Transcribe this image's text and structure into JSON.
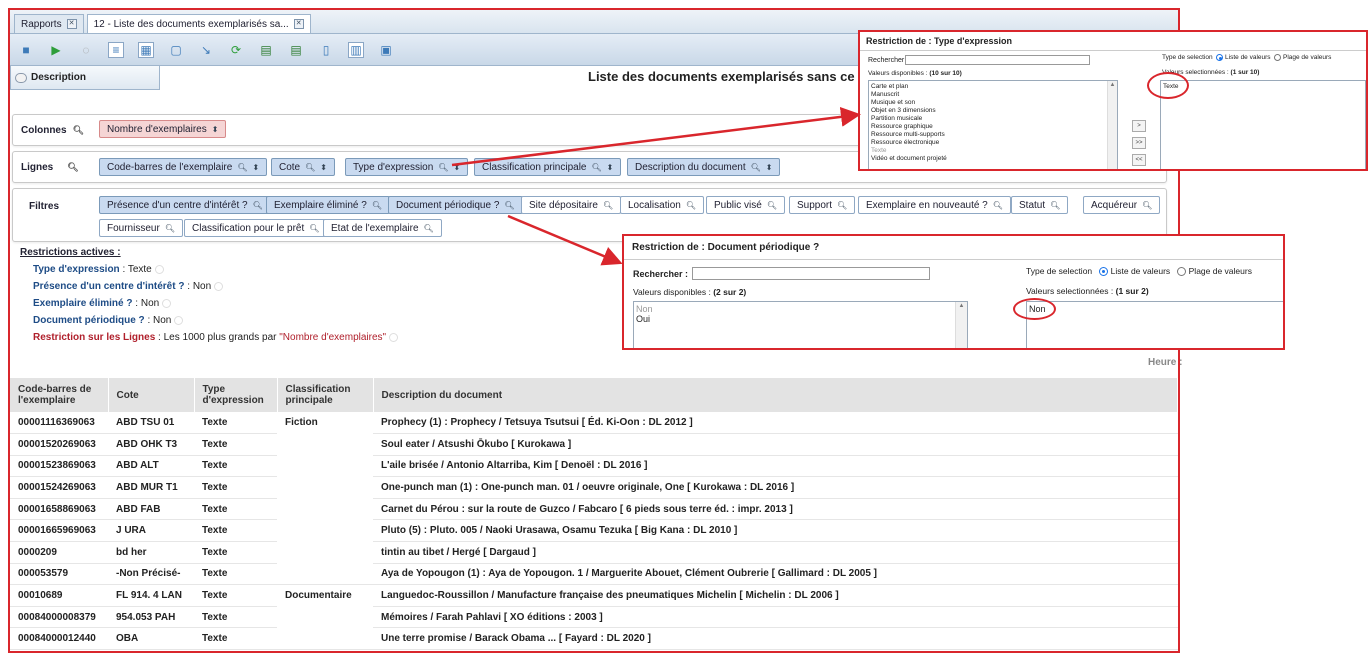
{
  "tabs": [
    {
      "label": "Rapports"
    },
    {
      "label": "12 - Liste des documents exemplarisés sa..."
    }
  ],
  "description_label": "Description",
  "report_title": "Liste des documents exemplarisés sans ce",
  "colonnes": {
    "label": "Colonnes",
    "chips": [
      "Nombre d'exemplaires"
    ]
  },
  "lignes": {
    "label": "Lignes",
    "chips": [
      "Code-barres de l'exemplaire",
      "Cote",
      "Type d'expression",
      "Classification principale",
      "Description du document"
    ]
  },
  "filtres": {
    "label": "Filtres",
    "row1": [
      "Présence d'un centre d'intérêt ?",
      "Exemplaire éliminé ?",
      "Document périodique ?",
      "Site dépositaire",
      "Localisation",
      "Public visé",
      "Support",
      "Exemplaire en nouveauté ?",
      "Statut",
      "Acquéreur"
    ],
    "row2": [
      "Fournisseur",
      "Classification pour le prêt",
      "Etat de l'exemplaire"
    ]
  },
  "restrictions": {
    "title": "Restrictions actives :",
    "items": [
      {
        "key": "Type d'expression",
        "value": "Texte"
      },
      {
        "key": "Présence d'un centre d'intérêt ?",
        "value": "Non"
      },
      {
        "key": "Exemplaire éliminé ?",
        "value": "Non"
      },
      {
        "key": "Document périodique ?",
        "value": "Non"
      }
    ],
    "lines_key": "Restriction sur les Lignes",
    "lines_value": "Les 1000 plus grands par",
    "lines_metric": "\"Nombre d'exemplaires\""
  },
  "heure_label": "Heure :",
  "table": {
    "headers": [
      "Code-barres de l'exemplaire",
      "Cote",
      "Type d'expression",
      "Classification principale",
      "Description du document"
    ],
    "rows": [
      [
        "00001116369063",
        "ABD TSU 01",
        "Texte",
        "Fiction",
        "Prophecy (1) : Prophecy / Tetsuya Tsutsui [ Éd. Ki-Oon : DL 2012 ]"
      ],
      [
        "00001520269063",
        "ABD OHK T3",
        "Texte",
        "",
        "Soul eater / Atsushi Ōkubo [ Kurokawa ]"
      ],
      [
        "00001523869063",
        "ABD ALT",
        "Texte",
        "",
        "L'aile brisée / Antonio Altarriba, Kim [ Denoël : DL 2016 ]"
      ],
      [
        "00001524269063",
        "ABD MUR T1",
        "Texte",
        "",
        "One-punch man (1) : One-punch man. 01 / oeuvre originale, One [ Kurokawa : DL 2016 ]"
      ],
      [
        "00001658869063",
        "ABD FAB",
        "Texte",
        "",
        "Carnet du Pérou : sur la route de Guzco / Fabcaro [ 6 pieds sous terre éd. : impr. 2013 ]"
      ],
      [
        "00001665969063",
        "J URA",
        "Texte",
        "",
        "Pluto (5) : Pluto. 005 / Naoki Urasawa, Osamu Tezuka [ Big Kana : DL 2010 ]"
      ],
      [
        "0000209",
        "bd her",
        "Texte",
        "",
        "tintin au tibet / Hergé [ Dargaud ]"
      ],
      [
        "000053579",
        "-Non Précisé-",
        "Texte",
        "",
        "Aya de Yopougon (1) : Aya de Yopougon. 1 / Marguerite Abouet, Clément Oubrerie [ Gallimard : DL 2005 ]"
      ],
      [
        "00010689",
        "FL 914. 4 LAN",
        "Texte",
        "Documentaire",
        "Languedoc-Roussillon / Manufacture française des pneumatiques Michelin [ Michelin : DL 2006 ]"
      ],
      [
        "00084000008379",
        "954.053 PAH",
        "Texte",
        "",
        "Mémoires / Farah Pahlavi [ XO éditions : 2003 ]"
      ],
      [
        "00084000012440",
        "OBA",
        "Texte",
        "",
        "Une terre promise / Barack Obama ... [ Fayard : DL 2020 ]"
      ]
    ]
  },
  "popup1": {
    "title": "Restriction de : Type d'expression",
    "search_label": "Rechercher :",
    "available_label": "Valeurs disponibles :",
    "available_count": "(10 sur 10)",
    "available": [
      "Carte et plan",
      "Manuscrit",
      "Musique et son",
      "Objet en 3 dimensions",
      "Partition musicale",
      "Ressource graphique",
      "Ressource multi-supports",
      "Ressource électronique",
      "Texte",
      "Vidéo et document projeté"
    ],
    "selection_type_label": "Type de selection",
    "opt_list": "Liste de valeurs",
    "opt_range": "Plage de valeurs",
    "selected_label": "Valeurs selectionnées :",
    "selected_count": "(1 sur 10)",
    "selected": [
      "Texte"
    ],
    "buttons": [
      ">",
      ">>",
      "<<"
    ]
  },
  "popup2": {
    "title": "Restriction de : Document périodique ?",
    "search_label": "Rechercher :",
    "available_label": "Valeurs disponibles :",
    "available_count": "(2 sur 2)",
    "available": [
      "Non",
      "Oui"
    ],
    "selection_type_label": "Type de selection",
    "opt_list": "Liste de valeurs",
    "opt_range": "Plage de valeurs",
    "selected_label": "Valeurs selectionnées :",
    "selected_count": "(1 sur 2)",
    "selected": [
      "Non"
    ]
  },
  "colors": {
    "accent": "#d9262c",
    "chip": "#c9daf0",
    "chip_pink": "#f5d5d5",
    "key_blue": "#1e4c86"
  }
}
